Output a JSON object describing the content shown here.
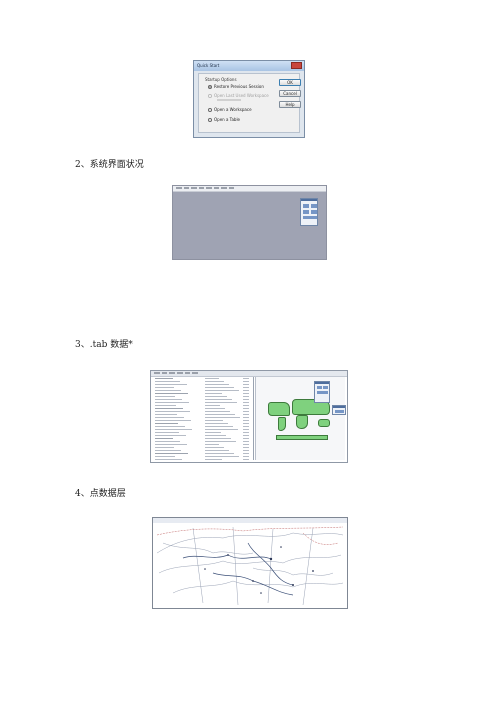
{
  "quick_start": {
    "title": "Quick Start",
    "group_label": "Startup Options",
    "options": [
      {
        "label": "Restore Previous Session",
        "selected": true,
        "enabled": true
      },
      {
        "label": "Open Last Used Workspace",
        "selected": false,
        "enabled": false
      },
      {
        "label": "Open a Workspace",
        "selected": false,
        "enabled": true
      },
      {
        "label": "Open a Table",
        "selected": false,
        "enabled": true
      }
    ],
    "buttons": {
      "ok": "OK",
      "cancel": "Cancel",
      "help": "Help"
    }
  },
  "sections": [
    {
      "heading": "2、系统界面状况"
    },
    {
      "heading": "3、.tab 数据*"
    },
    {
      "heading": "4、点数据层"
    }
  ],
  "colors": {
    "workspace_bg": "#9fa3b3",
    "land_fill": "#7fd17e",
    "panel_accent": "#4e6e9e"
  }
}
